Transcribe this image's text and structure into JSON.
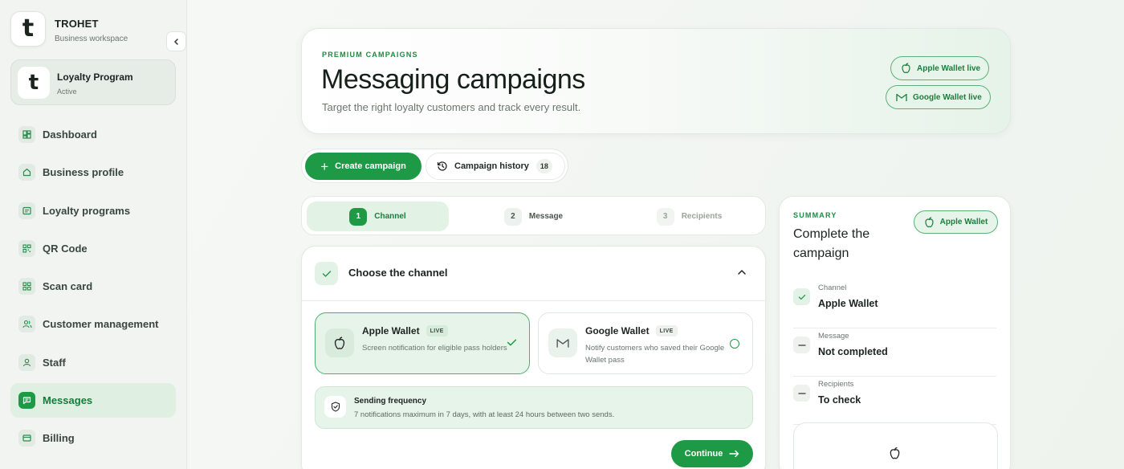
{
  "sidebar": {
    "brand_name": "TROHET",
    "brand_subtitle": "Business workspace",
    "program": {
      "name": "Loyalty Program",
      "status": "Active"
    },
    "items": [
      {
        "label": "Dashboard",
        "icon": "dashboard-icon"
      },
      {
        "label": "Business profile",
        "icon": "home-icon"
      },
      {
        "label": "Loyalty programs",
        "icon": "card-icon"
      },
      {
        "label": "QR Code",
        "icon": "qr-code-icon"
      },
      {
        "label": "Scan card",
        "icon": "scan-icon"
      },
      {
        "label": "Customer management",
        "icon": "users-icon"
      },
      {
        "label": "Staff",
        "icon": "user-icon"
      },
      {
        "label": "Messages",
        "icon": "message-icon",
        "active": true
      },
      {
        "label": "Billing",
        "icon": "billing-icon"
      }
    ]
  },
  "hero": {
    "kicker": "PREMIUM CAMPAIGNS",
    "title": "Messaging campaigns",
    "subtitle": "Target the right loyalty customers and track every result.",
    "badges": [
      {
        "label": "Apple Wallet live",
        "icon": "apple-icon"
      },
      {
        "label": "Google Wallet live",
        "icon": "gmail-icon"
      }
    ]
  },
  "actions": {
    "create_label": "Create campaign",
    "history_label": "Campaign history",
    "history_count": "18"
  },
  "steps": [
    {
      "num": "1",
      "label": "Channel",
      "state": "active"
    },
    {
      "num": "2",
      "label": "Message",
      "state": "pending"
    },
    {
      "num": "3",
      "label": "Recipients",
      "state": "disabled"
    }
  ],
  "channel": {
    "title": "Choose the channel",
    "options": [
      {
        "name": "Apple Wallet",
        "badge": "LIVE",
        "description": "Screen notification for eligible pass holders",
        "selected": true
      },
      {
        "name": "Google Wallet",
        "badge": "LIVE",
        "description": "Notify customers who saved their Google Wallet pass",
        "selected": false
      }
    ],
    "frequency": {
      "title": "Sending frequency",
      "description": "7 notifications maximum in 7 days, with at least 24 hours between two sends."
    },
    "continue_label": "Continue"
  },
  "summary": {
    "kicker": "SUMMARY",
    "title": "Complete the campaign",
    "channel_badge": "Apple Wallet",
    "rows": [
      {
        "label": "Channel",
        "value": "Apple Wallet",
        "status": "done"
      },
      {
        "label": "Message",
        "value": "Not completed",
        "status": "pending"
      },
      {
        "label": "Recipients",
        "value": "To check",
        "status": "pending"
      }
    ]
  },
  "colors": {
    "accent": "#1e9a47",
    "accent_light": "#e6f4e9",
    "text": "#1c2420",
    "muted": "#6b766f"
  }
}
